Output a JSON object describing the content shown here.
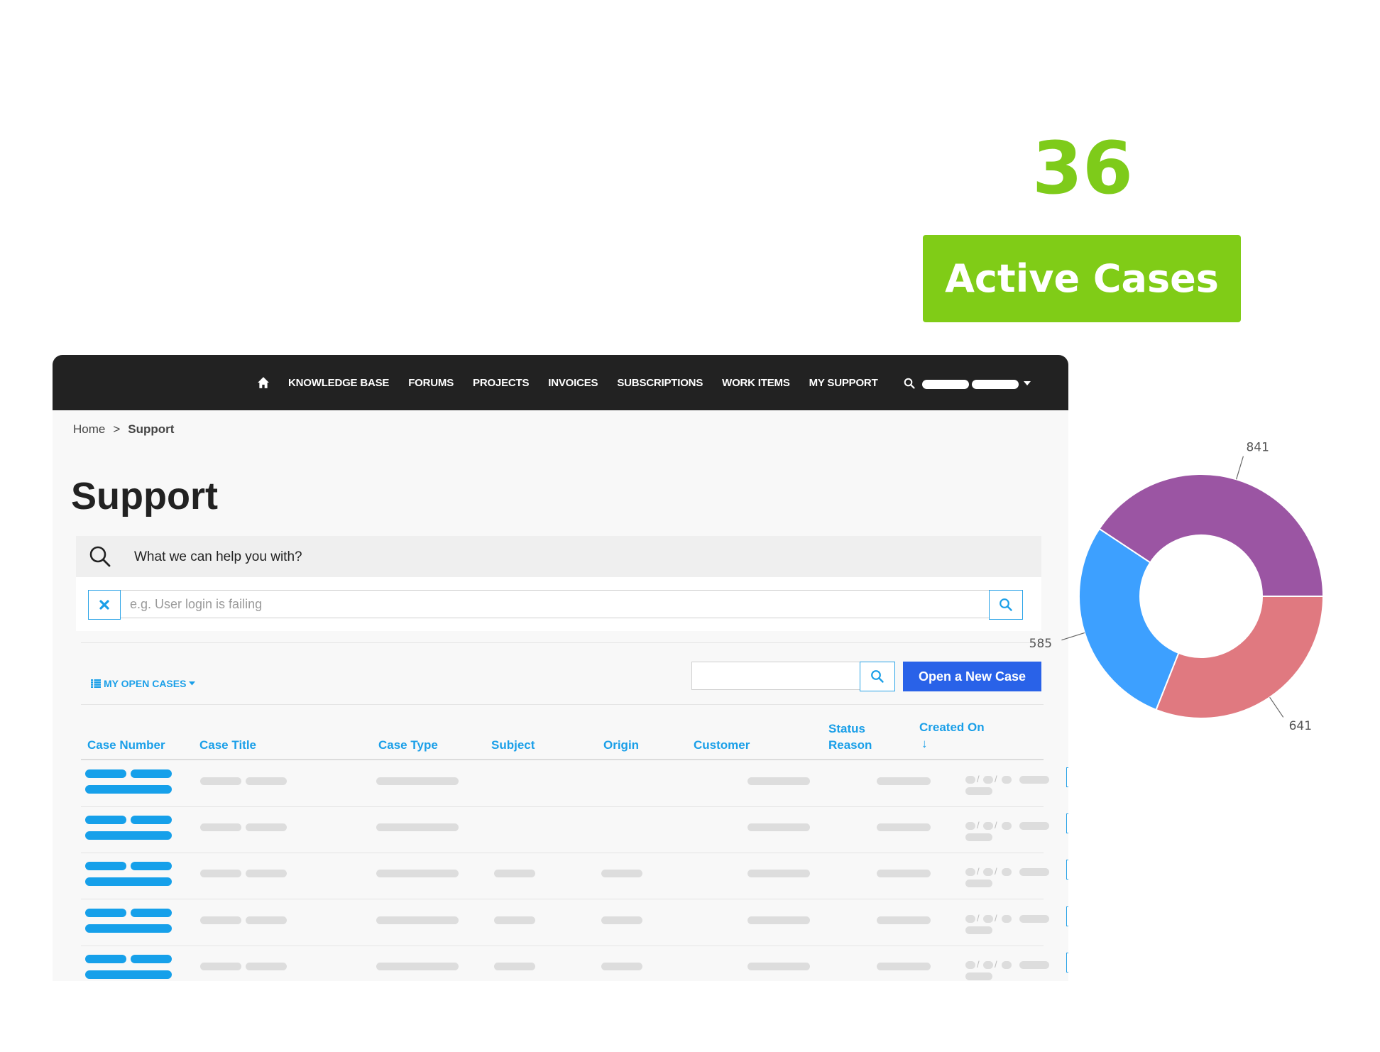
{
  "stat": {
    "value": "36",
    "label": "Active Cases"
  },
  "nav": {
    "items": [
      "KNOWLEDGE BASE",
      "FORUMS",
      "PROJECTS",
      "INVOICES",
      "SUBSCRIPTIONS",
      "WORK ITEMS",
      "MY SUPPORT"
    ]
  },
  "breadcrumb": {
    "home": "Home",
    "separator": ">",
    "current": "Support"
  },
  "page": {
    "title": "Support"
  },
  "help": {
    "prompt": "What we can help you with?"
  },
  "search": {
    "placeholder": "e.g. User login is failing"
  },
  "cases": {
    "view_label": "MY OPEN CASES",
    "new_case_label": "Open a New Case",
    "columns": {
      "case_number": "Case Number",
      "case_title": "Case Title",
      "case_type": "Case Type",
      "subject": "Subject",
      "origin": "Origin",
      "customer": "Customer",
      "status_reason_1": "Status",
      "status_reason_2": "Reason",
      "created_on": "Created On"
    },
    "sort_indicator": "↓"
  },
  "colors": {
    "accent_green": "#80cc17",
    "nav_dark": "#222222",
    "link_blue": "#1a9fe8",
    "button_blue": "#2962e8"
  },
  "chart_data": {
    "type": "pie",
    "donut": true,
    "slices": [
      {
        "value": 841,
        "label": "841",
        "color": "#9b55a3"
      },
      {
        "value": 641,
        "label": "641",
        "color": "#e07980"
      },
      {
        "value": 585,
        "label": "585",
        "color": "#3da0ff"
      }
    ]
  }
}
